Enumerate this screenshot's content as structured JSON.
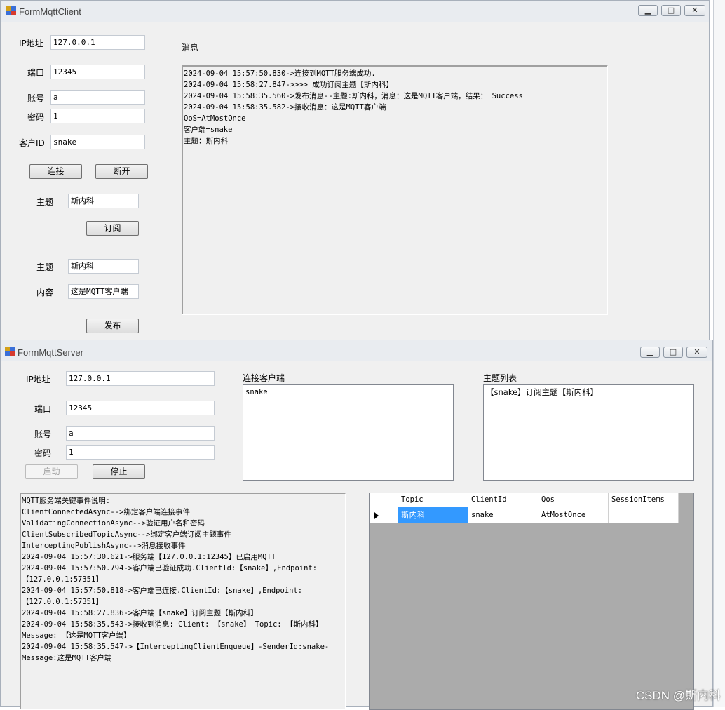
{
  "client": {
    "title": "FormMqttClient",
    "ip_label": "IP地址",
    "ip_value": "127.0.0.1",
    "port_label": "端口",
    "port_value": "12345",
    "account_label": "账号",
    "account_value": "a",
    "password_label": "密码",
    "password_value": "1",
    "clientid_label": "客户ID",
    "clientid_value": "snake",
    "connect_label": "连接",
    "disconnect_label": "断开",
    "sub_topic_label": "主题",
    "sub_topic_value": "斯内科",
    "subscribe_label": "订阅",
    "pub_topic_label": "主题",
    "pub_topic_value": "斯内科",
    "content_label": "内容",
    "content_value": "这是MQTT客户端",
    "publish_label": "发布",
    "messages_label": "消息",
    "messages": [
      "2024-09-04 15:57:50.830->连接到MQTT服务端成功.",
      "2024-09-04 15:58:27.847->>>> 成功订阅主题【斯内科】",
      "2024-09-04 15:58:35.560->发布消息--主题:斯内科，消息：这是MQTT客户端，结果： Success",
      "2024-09-04 15:58:35.582->接收消息：这是MQTT客户端",
      "QoS=AtMostOnce",
      "客户端=snake",
      "主题：斯内科"
    ]
  },
  "server": {
    "title": "FormMqttServer",
    "ip_label": "IP地址",
    "ip_value": "127.0.0.1",
    "port_label": "端口",
    "port_value": "12345",
    "account_label": "账号",
    "account_value": "a",
    "password_label": "密码",
    "password_value": "1",
    "start_label": "启动",
    "stop_label": "停止",
    "clients_label": "连接客户端",
    "clients": [
      "snake"
    ],
    "topics_label": "主题列表",
    "topics": [
      "【snake】订阅主题【斯内科】"
    ],
    "log": [
      "MQTT服务端关键事件说明:",
      "ClientConnectedAsync-->绑定客户端连接事件",
      "ValidatingConnectionAsync-->验证用户名和密码",
      "ClientSubscribedTopicAsync-->绑定客户端订阅主题事件",
      "InterceptingPublishAsync-->消息接收事件",
      "2024-09-04 15:57:30.621->服务端【127.0.0.1:12345】已启用MQTT",
      "2024-09-04 15:57:50.794->客户端已验证成功.ClientId:【snake】,Endpoint:",
      "【127.0.0.1:57351】",
      "2024-09-04 15:57:50.818->客户端已连接.ClientId:【snake】,Endpoint:",
      "【127.0.0.1:57351】",
      "2024-09-04 15:58:27.836->客户端【snake】订阅主题【斯内科】",
      "2024-09-04 15:58:35.543->接收到消息: Client: 【snake】 Topic: 【斯内科】",
      "Message: 【这是MQTT客户端】",
      "2024-09-04 15:58:35.547->【InterceptingClientEnqueue】-SenderId:snake-",
      "Message:这是MQTT客户端"
    ],
    "grid": {
      "headers": [
        "Topic",
        "ClientId",
        "Qos",
        "SessionItems"
      ],
      "rows": [
        [
          "斯内科",
          "snake",
          "AtMostOnce",
          ""
        ]
      ],
      "selected_color": "#3399ff",
      "background_color": "#ababab"
    }
  },
  "watermark": "CSDN @斯内科"
}
